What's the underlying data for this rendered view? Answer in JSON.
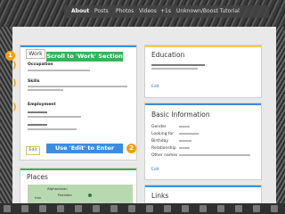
{
  "browser": {
    "tabs": [
      "About",
      "Posts",
      "Photos",
      "Videos",
      "+1s",
      "Unknown/Boost Tutorial"
    ],
    "active_tab": "About"
  },
  "work_card": {
    "tab_label": "Work",
    "fields": [
      {
        "label": "Occupation"
      },
      {
        "label": "Skills"
      },
      {
        "label": "Employment"
      }
    ],
    "edit_label": "Edit"
  },
  "education_card": {
    "title": "Education",
    "edit_label": "Edit"
  },
  "basic_info_card": {
    "title": "Basic Information",
    "rows": [
      "Gender",
      "Looking for",
      "Birthday",
      "Relationship",
      "Other names"
    ],
    "edit_label": "Edit"
  },
  "places_card": {
    "title": "Places",
    "map_labels": [
      "Afghanistan",
      "Pakistan",
      "Iran"
    ]
  },
  "links_card": {
    "title": "Links"
  },
  "callouts": {
    "step1_number": "1",
    "step1_text": "Scroll to 'Work' Section",
    "step2_number": "2",
    "step2_text": "Use 'Edit' to Enter"
  },
  "colors": {
    "accent_green": "#36b35a",
    "accent_blue": "#3c8de0",
    "badge_orange": "#f5a000"
  }
}
